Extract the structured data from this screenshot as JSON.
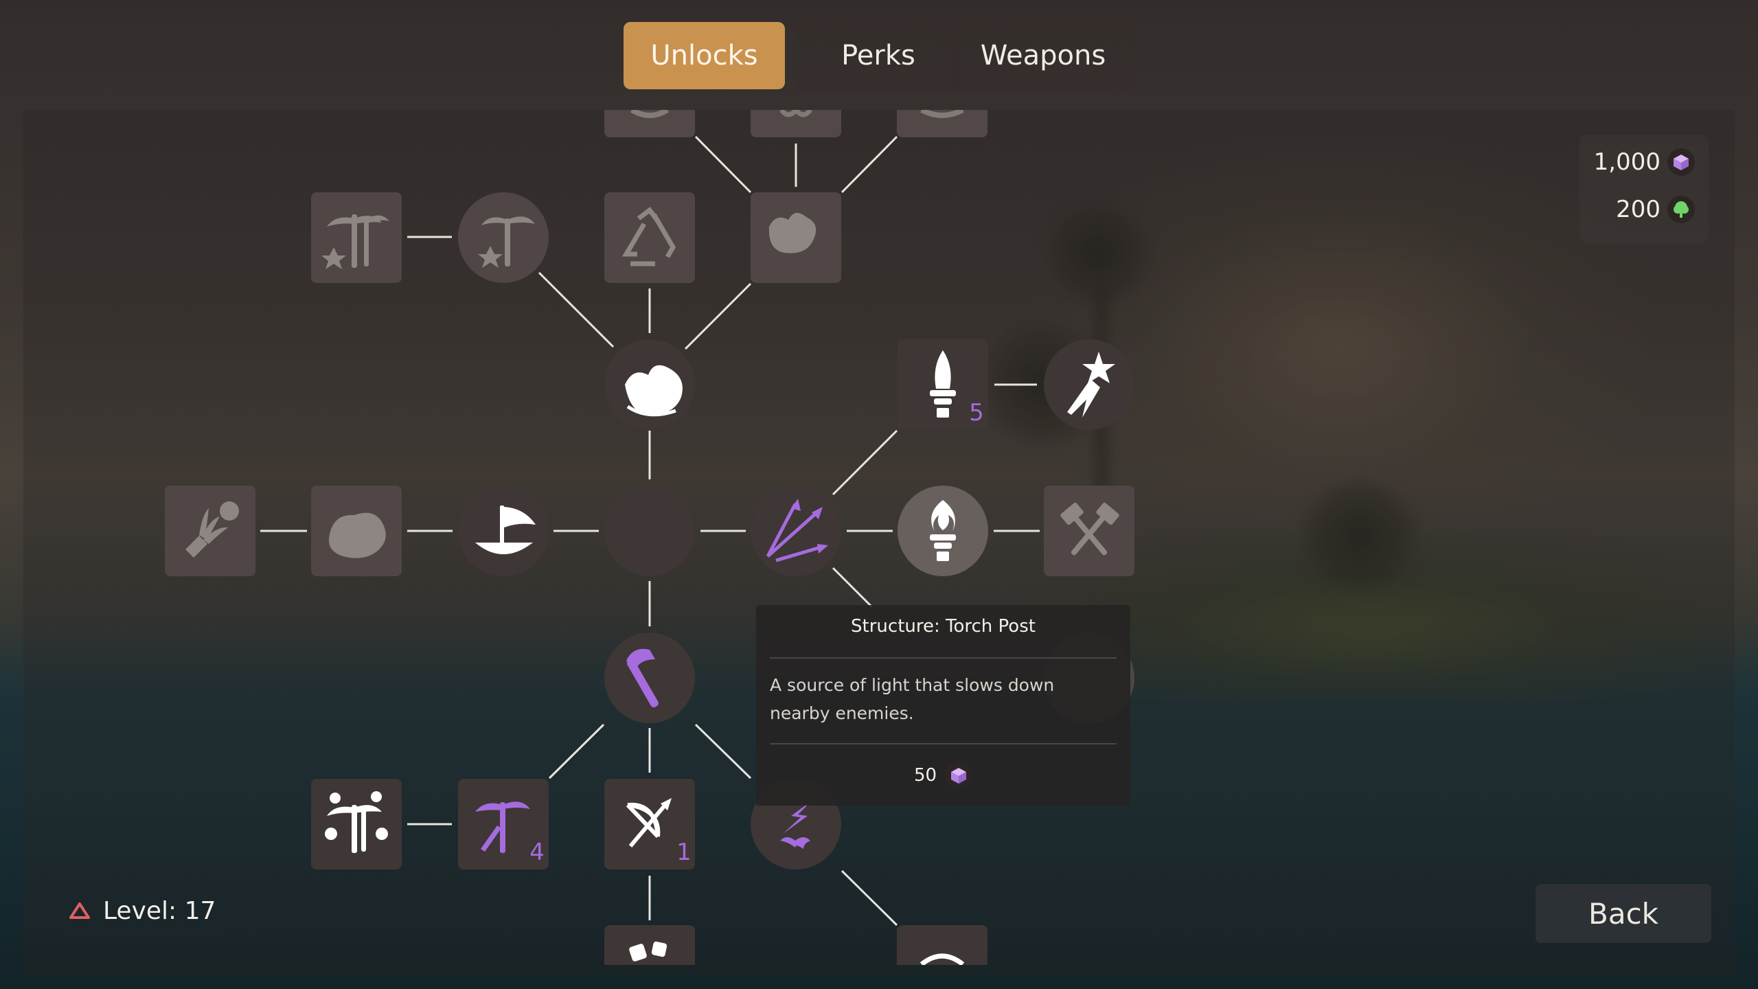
{
  "tabs": [
    {
      "label": "Unlocks",
      "active": true
    },
    {
      "label": "Perks",
      "active": false
    },
    {
      "label": "Weapons",
      "active": false
    }
  ],
  "currency": {
    "crystals": {
      "value": "1,000",
      "icon": "purple-cube-icon",
      "color": "#b583e6"
    },
    "wood": {
      "value": "200",
      "icon": "green-tree-icon",
      "color": "#6fd46a"
    }
  },
  "tooltip": {
    "title": "Structure: Torch Post",
    "description": "A source of light that slows down nearby enemies.",
    "cost": "50",
    "cost_icon": "purple-cube-icon"
  },
  "player": {
    "level_text": "Level: 17",
    "icon": "level-triangle-icon",
    "icon_color": "#e06060"
  },
  "buttons": {
    "back": "Back"
  },
  "nodes": [
    {
      "id": "top-left-partial",
      "icon": "shield-icon",
      "state": "locked"
    },
    {
      "id": "top-mid-partial",
      "icon": "fleur-icon",
      "state": "locked"
    },
    {
      "id": "top-right-partial",
      "icon": "ring-icon",
      "state": "locked"
    },
    {
      "id": "palm-spark-square",
      "icon": "palm-spark-icon",
      "state": "locked"
    },
    {
      "id": "palm-spark-circle",
      "icon": "palm-spark-icon",
      "state": "locked"
    },
    {
      "id": "recycle",
      "icon": "recycle-icon",
      "state": "locked"
    },
    {
      "id": "wind-flower",
      "icon": "wind-flower-icon",
      "state": "locked"
    },
    {
      "id": "swirl-flower",
      "icon": "swirl-flower-icon",
      "state": "unlocked"
    },
    {
      "id": "rocket-torch",
      "icon": "rocket-torch-icon",
      "state": "unlocked",
      "badge": "5"
    },
    {
      "id": "magic-wand",
      "icon": "magic-wand-icon",
      "state": "unlocked"
    },
    {
      "id": "wheat-bundle",
      "icon": "wheat-bundle-icon",
      "state": "locked"
    },
    {
      "id": "rock",
      "icon": "rock-icon",
      "state": "locked"
    },
    {
      "id": "boat-sail",
      "icon": "boat-sail-icon",
      "state": "unlocked"
    },
    {
      "id": "center",
      "icon": "",
      "state": "hub"
    },
    {
      "id": "arrows",
      "icon": "triple-arrow-icon",
      "state": "purchased"
    },
    {
      "id": "torch-post",
      "icon": "torch-icon",
      "state": "hovered"
    },
    {
      "id": "hammers",
      "icon": "crossed-hammers-icon",
      "state": "locked"
    },
    {
      "id": "axe",
      "icon": "axe-icon",
      "state": "purchased"
    },
    {
      "id": "palm-fruit",
      "icon": "palm-fruit-icon",
      "state": "unlocked"
    },
    {
      "id": "palm-chop",
      "icon": "palm-chop-icon",
      "state": "purchased",
      "badge": "4"
    },
    {
      "id": "bow",
      "icon": "bow-arrow-icon",
      "state": "unlocked",
      "badge": "1"
    },
    {
      "id": "lightning-wave",
      "icon": "lightning-wave-icon",
      "state": "purchased"
    },
    {
      "id": "dice-partial",
      "icon": "dice-icon",
      "state": "unlocked"
    },
    {
      "id": "ring-partial",
      "icon": "ring-icon",
      "state": "unlocked"
    },
    {
      "id": "hidden-behind-tooltip",
      "icon": "circle-icon",
      "state": "locked"
    }
  ],
  "colors": {
    "accent": "#c9924f",
    "purple": "#a66bde",
    "locked": "#8d8683",
    "unlocked": "#ffffff"
  }
}
